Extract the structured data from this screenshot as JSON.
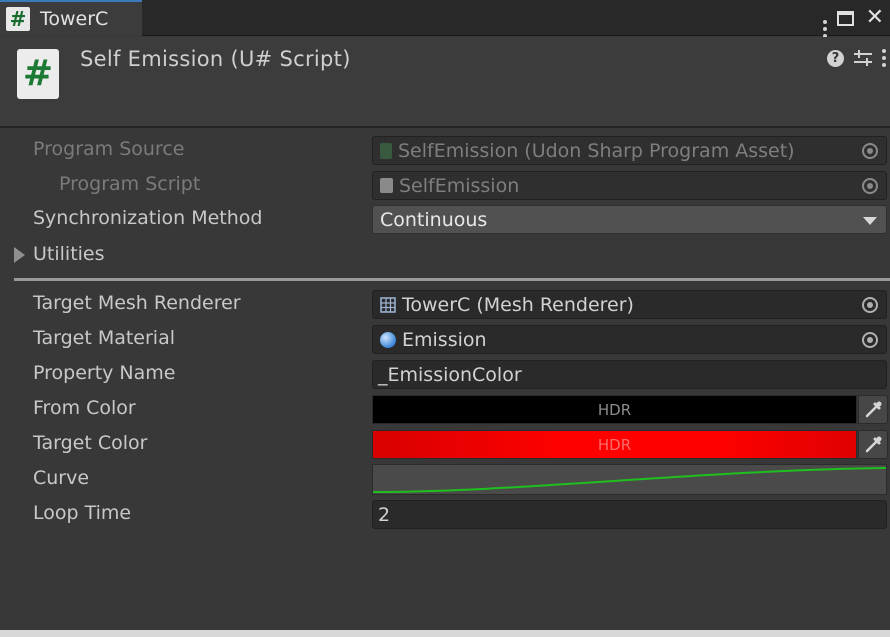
{
  "tab": {
    "title": "TowerC",
    "icon": "hash-script-icon"
  },
  "window_controls": {
    "menu_icon": "kebab-menu-icon",
    "maximize_icon": "maximize-icon",
    "close_icon": "close-icon"
  },
  "component": {
    "title": "Self Emission (U# Script)",
    "icon_glyph": "#",
    "help_icon": "help-icon",
    "presets_icon": "presets-sliders-icon",
    "menu_icon": "kebab-menu-icon"
  },
  "udon": {
    "program_source": {
      "label": "Program Source",
      "value": "SelfEmission (Udon Sharp Program Asset)"
    },
    "program_script": {
      "label": "Program Script",
      "value": "SelfEmission"
    },
    "sync_method": {
      "label": "Synchronization Method",
      "value": "Continuous"
    },
    "utilities": {
      "label": "Utilities"
    }
  },
  "fields": {
    "target_mesh_renderer": {
      "label": "Target Mesh Renderer",
      "value": "TowerC (Mesh Renderer)"
    },
    "target_material": {
      "label": "Target Material",
      "value": "Emission"
    },
    "property_name": {
      "label": "Property Name",
      "value": "_EmissionColor"
    },
    "from_color": {
      "label": "From Color",
      "badge": "HDR",
      "color": "#000000"
    },
    "target_color": {
      "label": "Target Color",
      "badge": "HDR",
      "color": "#ff0000"
    },
    "curve": {
      "label": "Curve",
      "line_color": "#1fbf1f"
    },
    "loop_time": {
      "label": "Loop Time",
      "value": "2"
    }
  },
  "colors": {
    "accent_tab": "#3a79bb",
    "panel_bg": "#383838"
  }
}
